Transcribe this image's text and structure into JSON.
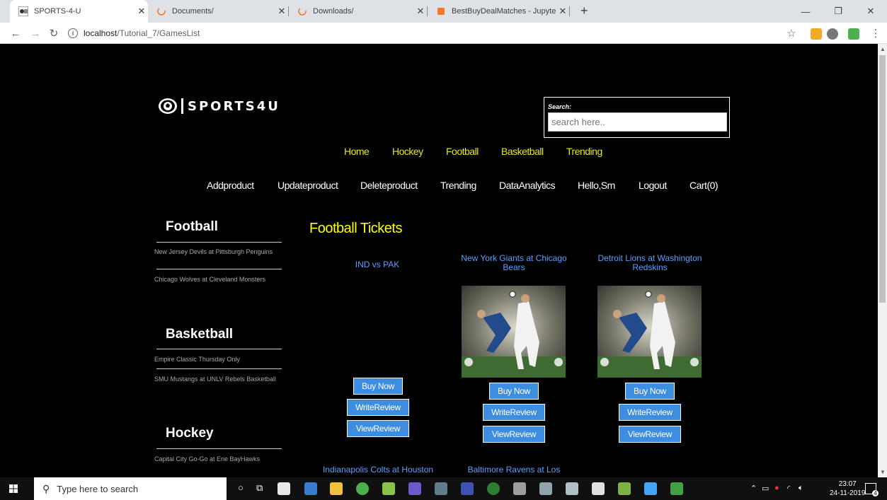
{
  "browser": {
    "tabs": [
      {
        "title": "SPORTS-4-U",
        "active": true
      },
      {
        "title": "Documents/",
        "active": false
      },
      {
        "title": "Downloads/",
        "active": false
      },
      {
        "title": "BestBuyDealMatches - Jupyter N",
        "active": false
      }
    ],
    "new_tab": "+",
    "url_host": "localhost",
    "url_path": "/Tutorial_7/GamesList"
  },
  "site": {
    "logo_text": "SPORTS4U",
    "search": {
      "label": "Search:",
      "placeholder": "search here.."
    },
    "primary_nav": [
      "Home",
      "Hockey",
      "Football",
      "Basketball",
      "Trending"
    ],
    "secondary_nav": [
      "Addproduct",
      "Updateproduct",
      "Deleteproduct",
      "Trending",
      "DataAnalytics",
      "Hello,Sm",
      "Logout",
      "Cart(0)"
    ]
  },
  "sidebar": {
    "football": {
      "heading": "Football",
      "items": [
        "New Jersey Devils at Pittsburgh Penguins",
        "Chicago Wolves at Cleveland Monsters"
      ]
    },
    "basketball": {
      "heading": "Basketball",
      "items": [
        "Empire Classic Thursday Only",
        "SMU Mustangs at UNLV Rebels Basketball"
      ]
    },
    "hockey": {
      "heading": "Hockey",
      "items": [
        "Capital City Go-Go at Erie BayHawks"
      ]
    }
  },
  "main": {
    "section_title": "Football Tickets",
    "cards": [
      {
        "title": "IND vs PAK",
        "buy": "Buy Now",
        "write": "WriteReview",
        "view": "ViewReview"
      },
      {
        "title": "New York Giants at Chicago Bears",
        "buy": "Buy Now",
        "write": "WriteReview",
        "view": "ViewReview"
      },
      {
        "title": "Detroit Lions at Washington Redskins",
        "buy": "Buy Now",
        "write": "WriteReview",
        "view": "ViewReview"
      }
    ],
    "next_row_titles": [
      "Indianapolis Colts at Houston",
      "Baltimore Ravens at Los"
    ]
  },
  "taskbar": {
    "search_placeholder": "Type here to search",
    "time": "23:07",
    "date": "24-11-2019",
    "notification_count": "4"
  },
  "colors": {
    "nav_primary": "#e8e81e",
    "section_title": "#ffff00",
    "card_title": "#5aa0ff",
    "button": "#3d8ee0"
  }
}
